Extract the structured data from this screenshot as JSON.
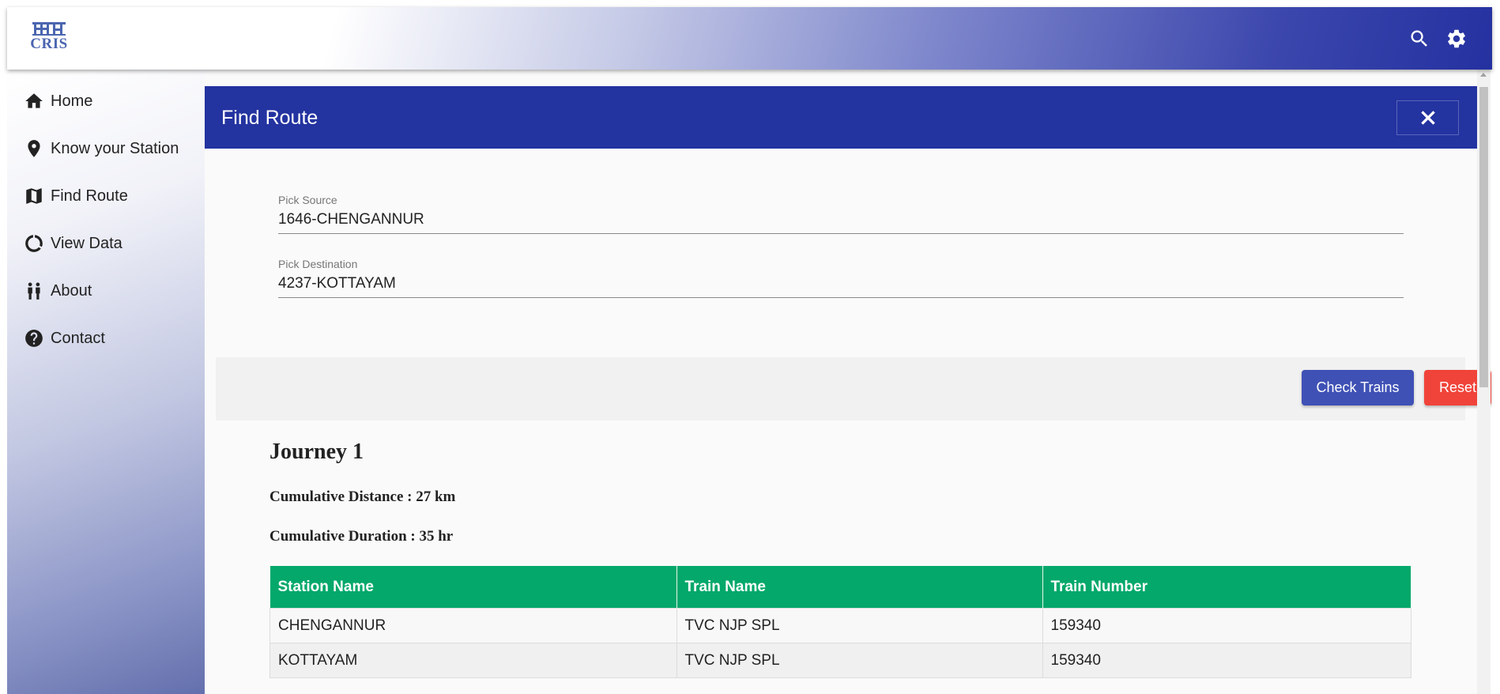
{
  "header": {
    "logo_text": "CRIS",
    "icons": [
      "search-icon",
      "gear-icon"
    ]
  },
  "sidebar": {
    "items": [
      {
        "label": "Home",
        "icon": "home-icon"
      },
      {
        "label": "Know your Station",
        "icon": "map-pin-icon"
      },
      {
        "label": "Find Route",
        "icon": "map-icon"
      },
      {
        "label": "View Data",
        "icon": "donut-chart-icon"
      },
      {
        "label": "About",
        "icon": "people-icon"
      },
      {
        "label": "Contact",
        "icon": "help-icon"
      }
    ]
  },
  "main": {
    "title": "Find Route",
    "source": {
      "label": "Pick Source",
      "value": "1646-CHENGANNUR"
    },
    "destination": {
      "label": "Pick Destination",
      "value": "4237-KOTTAYAM"
    },
    "buttons": {
      "check": "Check Trains",
      "reset": "Reset"
    },
    "journey": {
      "title": "Journey 1",
      "distance": "Cumulative Distance : 27 km",
      "duration": "Cumulative Duration : 35 hr",
      "columns": [
        "Station Name",
        "Train Name",
        "Train Number"
      ],
      "rows": [
        [
          "CHENGANNUR",
          "TVC NJP SPL",
          "159340"
        ],
        [
          "KOTTAYAM",
          "TVC NJP SPL",
          "159340"
        ]
      ]
    }
  },
  "colors": {
    "title_bar": "#2333a0",
    "table_header": "#03a86a",
    "check_button": "#3f51b5",
    "reset_button": "#f0443a"
  }
}
